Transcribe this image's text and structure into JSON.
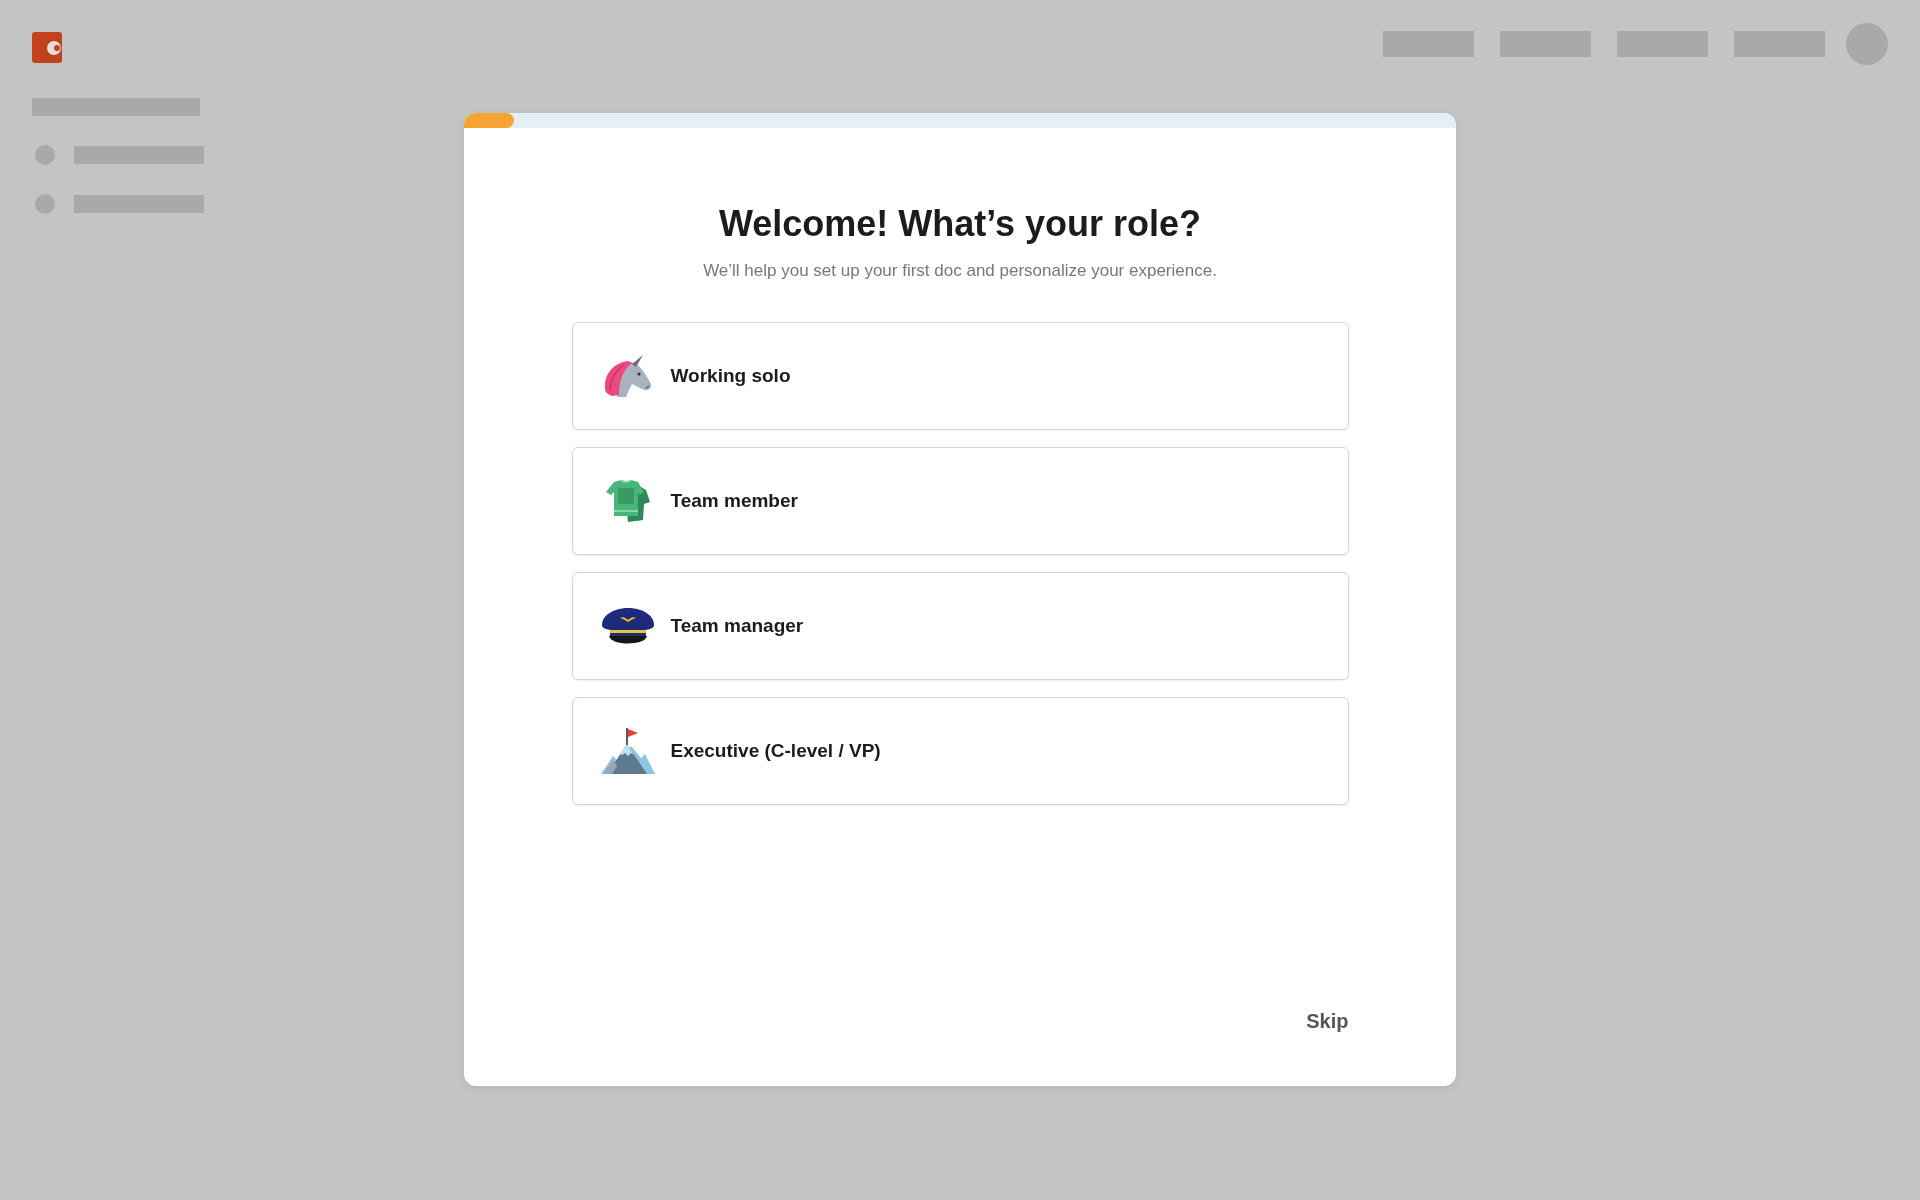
{
  "dialog": {
    "progress": {
      "level": 0.05
    },
    "title": "Welcome! What’s your role?",
    "subtitle": "We’ll help you set up your first doc and personalize your experience.",
    "options": [
      {
        "label": "Working solo",
        "kind": "unicorn",
        "selected": false
      },
      {
        "label": "Team member",
        "kind": "jersey",
        "selected": false
      },
      {
        "label": "Team manager",
        "kind": "cap",
        "selected": false
      },
      {
        "label": "Executive (C-level / VP)",
        "kind": "mountain",
        "selected": false
      }
    ],
    "skip": "Skip"
  }
}
